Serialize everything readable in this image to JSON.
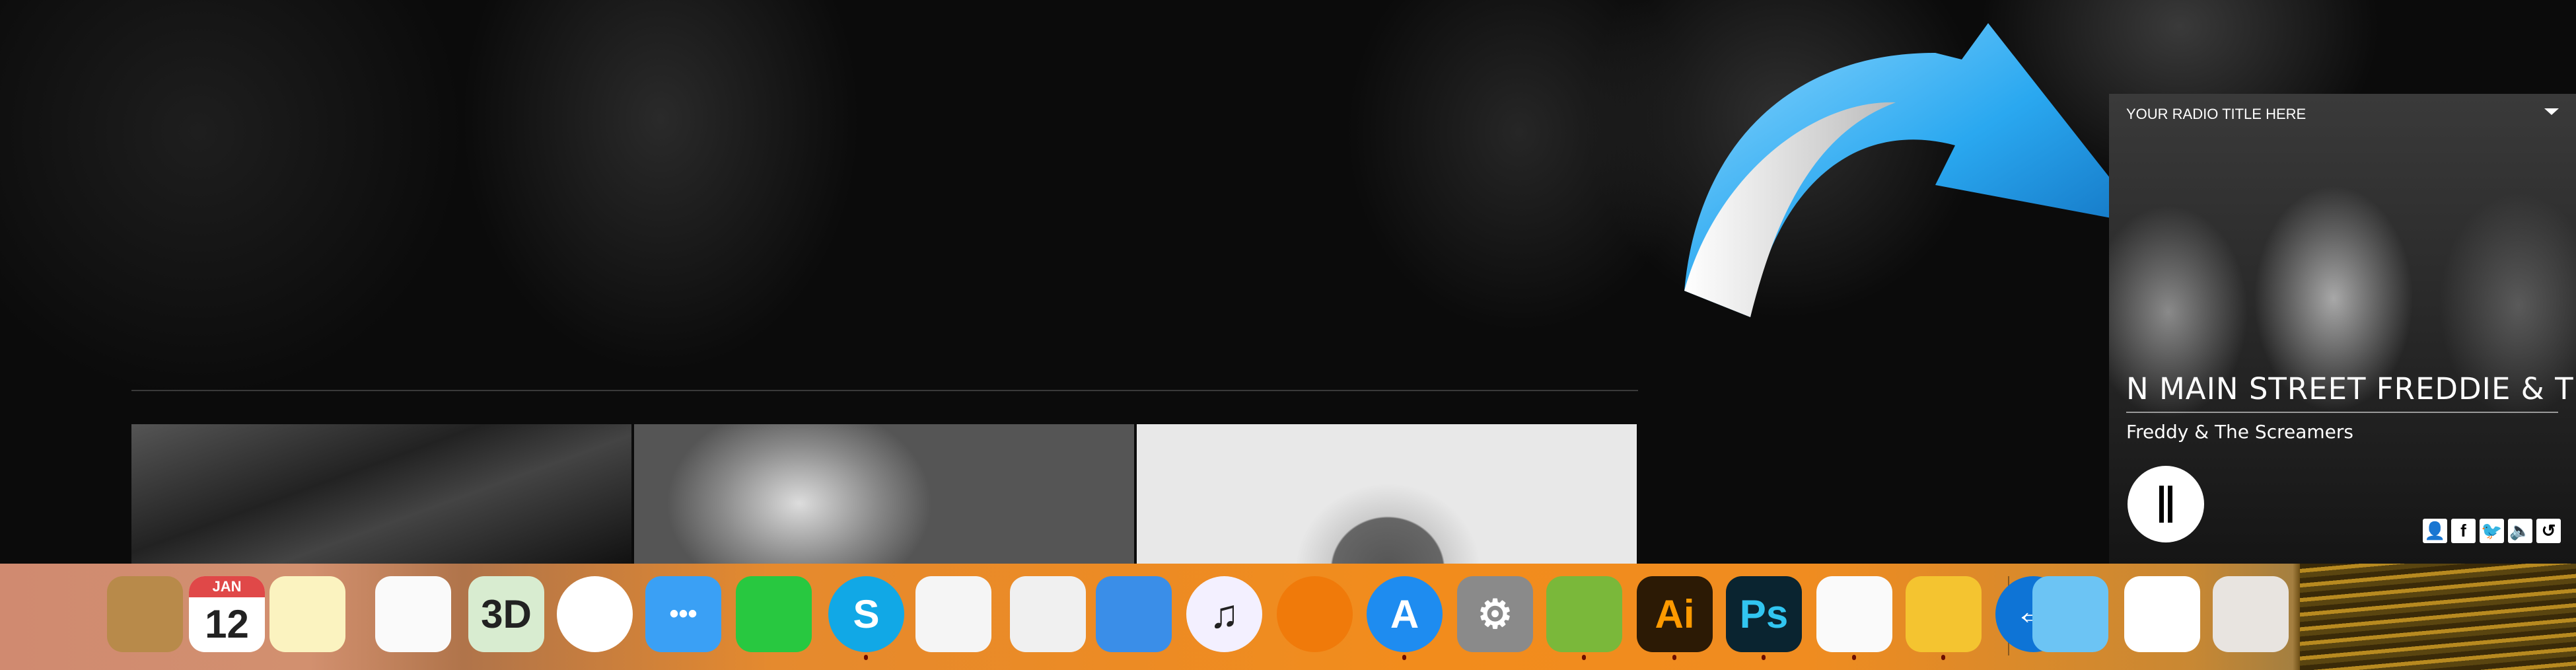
{
  "radio": {
    "title": "YOUR RADIO TITLE HERE",
    "song_title": "N MAIN STREET FREDDIE & THE",
    "artist": "Freddy & The Screamers",
    "state": "playing",
    "social_icons": [
      "user-icon",
      "facebook-icon",
      "twitter-icon",
      "volume-icon",
      "history-icon"
    ]
  },
  "colors": {
    "arrow": "#2aa8f0",
    "dock_left": "#d08a70",
    "dock_main": "#f28c1c"
  },
  "dock": {
    "apps": [
      {
        "icon": "contacts-icon",
        "glyph": "",
        "bg": "#b88a4a"
      },
      {
        "icon": "calendar-icon",
        "glyph": "12",
        "sub": "JAN",
        "bg": "#ffffff"
      },
      {
        "icon": "notes-icon",
        "glyph": "",
        "bg": "#fbf3c0"
      },
      {
        "icon": "reminders-icon",
        "glyph": "",
        "bg": "#fafafa"
      },
      {
        "icon": "maps-icon",
        "glyph": "3D",
        "bg": "#d8ecd0"
      },
      {
        "icon": "photos-icon",
        "glyph": "",
        "bg": "#ffffff"
      },
      {
        "icon": "messages-icon",
        "glyph": "•••",
        "bg": "#3aa0f5"
      },
      {
        "icon": "facetime-icon",
        "glyph": "",
        "bg": "#28c840"
      },
      {
        "icon": "skype-icon",
        "glyph": "S",
        "bg": "#11a8e6",
        "running": true
      },
      {
        "icon": "pages-icon",
        "glyph": "",
        "bg": "#f5f5f5"
      },
      {
        "icon": "numbers-icon",
        "glyph": "",
        "bg": "#f0f0f0"
      },
      {
        "icon": "keynote-icon",
        "glyph": "",
        "bg": "#3a8ee8"
      },
      {
        "icon": "itunes-icon",
        "glyph": "♫",
        "bg": "#f3f0ff"
      },
      {
        "icon": "ibooks-icon",
        "glyph": "",
        "bg": "#f07a0a"
      },
      {
        "icon": "app-store-icon",
        "glyph": "A",
        "bg": "#1e8cf0",
        "running": true
      },
      {
        "icon": "system-preferences-icon",
        "glyph": "⚙",
        "bg": "#8a8a8a"
      },
      {
        "icon": "frog-app-icon",
        "glyph": "",
        "bg": "#7ab83a",
        "running": true
      },
      {
        "icon": "illustrator-icon",
        "glyph": "Ai",
        "bg": "#2c1a05",
        "running": true
      },
      {
        "icon": "photoshop-icon",
        "glyph": "Ps",
        "bg": "#0a2430",
        "running": true
      },
      {
        "icon": "textedit-icon",
        "glyph": "",
        "bg": "#fafafa",
        "running": true
      },
      {
        "icon": "transmit-icon",
        "glyph": "",
        "bg": "#f4c430",
        "running": true
      },
      {
        "icon": "teamviewer-icon",
        "glyph": "⇔",
        "bg": "#0e74d6"
      },
      {
        "icon": "downloads-folder-icon",
        "glyph": "",
        "bg": "#6cc4f4"
      },
      {
        "icon": "skype-window-icon",
        "glyph": "",
        "bg": "#ffffff"
      },
      {
        "icon": "trash-icon",
        "glyph": "",
        "bg": "#e8e4e0"
      }
    ]
  }
}
